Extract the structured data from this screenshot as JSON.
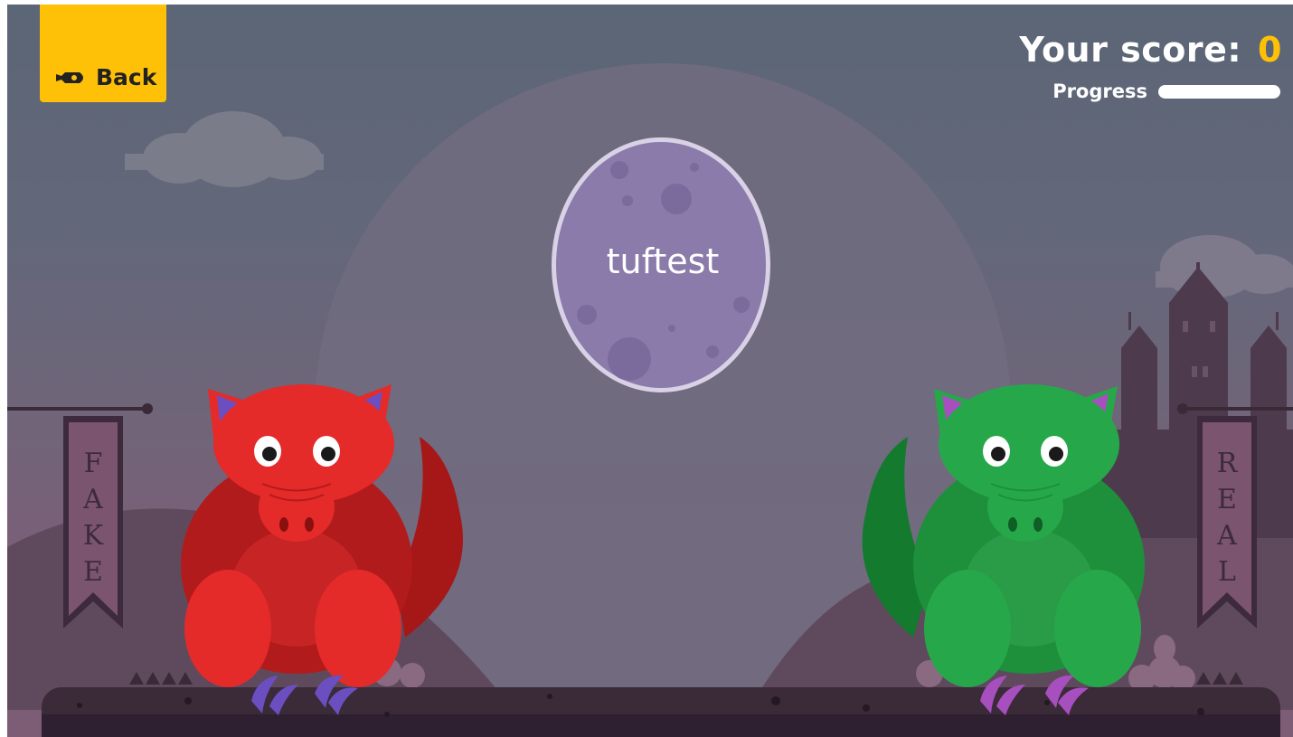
{
  "back_button": {
    "label": "Back",
    "icon": "rocket-icon"
  },
  "score": {
    "label": "Your score:",
    "value": "0"
  },
  "progress": {
    "label": "Progress",
    "fraction": 0
  },
  "egg": {
    "word": "tuftest"
  },
  "banners": {
    "left": {
      "letters": [
        "F",
        "A",
        "K",
        "E"
      ]
    },
    "right": {
      "letters": [
        "R",
        "E",
        "A",
        "L"
      ]
    }
  },
  "colors": {
    "accent": "#ffc107",
    "red_dragon": "#e52a2a",
    "green_dragon": "#26a84a",
    "egg": "#8a7bab"
  }
}
